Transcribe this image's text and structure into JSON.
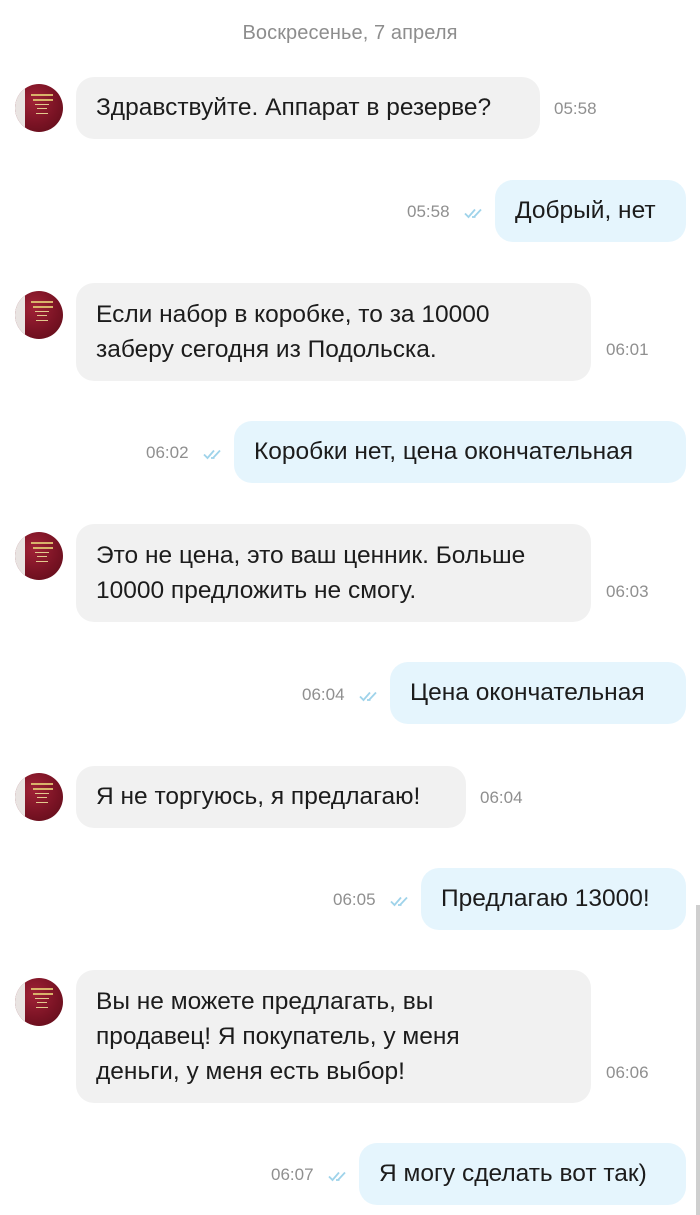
{
  "chat": {
    "date_separator": "Воскресенье, 7 апреля",
    "messages": [
      {
        "direction": "in",
        "text": "Здравствуйте. Аппарат в резерве?",
        "time": "05:58"
      },
      {
        "direction": "out",
        "text": "Добрый, нет",
        "time": "05:58",
        "status": "read"
      },
      {
        "direction": "in",
        "text": "Если набор в коробке, то за 10000\nзаберу сегодня из Подольска.",
        "time": "06:01"
      },
      {
        "direction": "out",
        "text": "Коробки нет, цена окончательная",
        "time": "06:02",
        "status": "read"
      },
      {
        "direction": "in",
        "text": "Это не цена, это ваш ценник. Больше\n10000 предложить не смогу.",
        "time": "06:03"
      },
      {
        "direction": "out",
        "text": "Цена окончательная",
        "time": "06:04",
        "status": "read"
      },
      {
        "direction": "in",
        "text": "Я не торгуюсь, я предлагаю!",
        "time": "06:04"
      },
      {
        "direction": "out",
        "text": "Предлагаю 13000!",
        "time": "06:05",
        "status": "read"
      },
      {
        "direction": "in",
        "text": "Вы не можете предлагать, вы\nпродавец! Я покупатель, у меня\nденьги, у меня есть выбор!",
        "time": "06:06"
      },
      {
        "direction": "out",
        "text": "Я могу сделать вот так)",
        "time": "06:07",
        "status": "read"
      }
    ]
  },
  "colors": {
    "incoming_bubble": "#f1f1f1",
    "outgoing_bubble": "#e5f5fd",
    "read_checks": "#9fd3ea",
    "timestamp": "#8f8f8f",
    "avatar": "#7a1324"
  },
  "icons": {
    "avatar": "contact-avatar",
    "read_status": "double-check-icon"
  }
}
